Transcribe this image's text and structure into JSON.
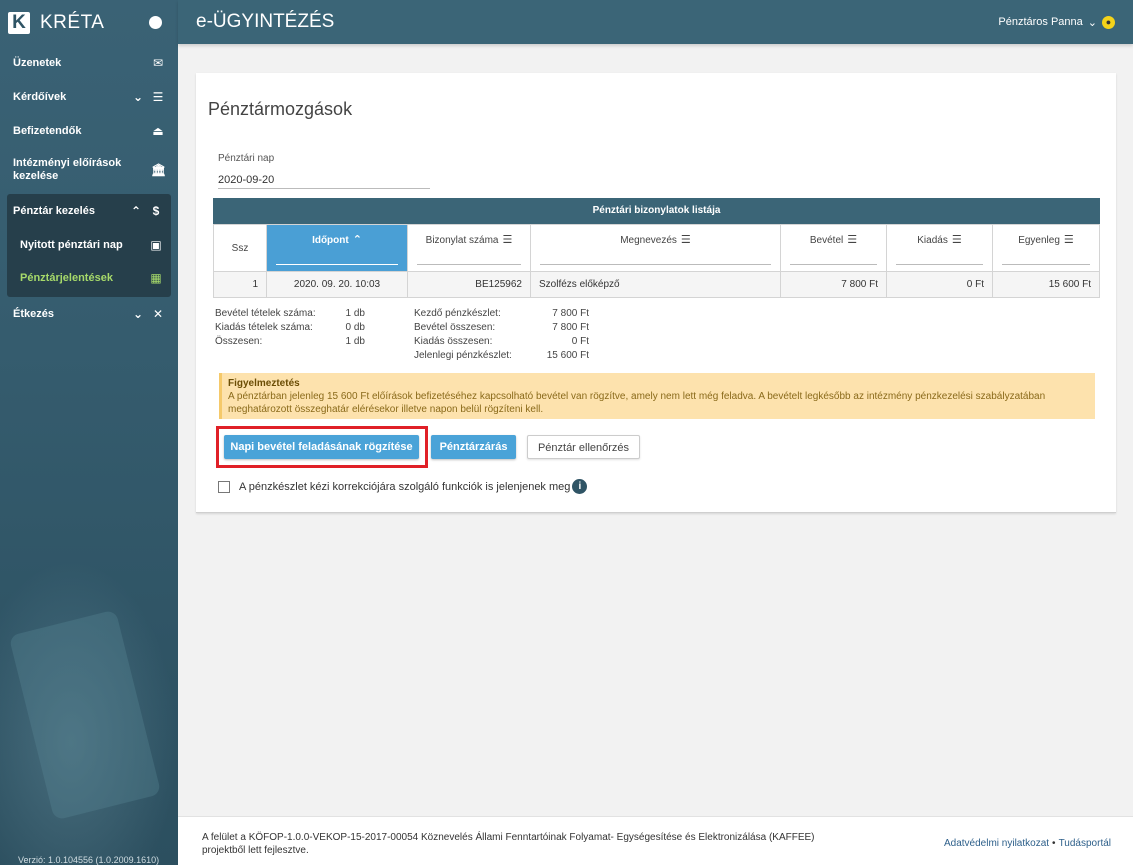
{
  "app": {
    "logo_letter": "K",
    "name": "KRÉTA",
    "module_title": "e-ÜGYINTÉZÉS",
    "user_name": "Pénztáros Panna",
    "version": "Verzió: 1.0.104556 (1.0.2009.1610)"
  },
  "sidebar": {
    "items": [
      {
        "label": "Üzenetek",
        "icon": "envelope-icon"
      },
      {
        "label": "Kérdőívek",
        "icon": "list-icon"
      },
      {
        "label": "Befizetendők",
        "icon": "stamp-icon"
      },
      {
        "label": "Intézményi előírások kezelése",
        "icon": "bank-icon"
      },
      {
        "label": "Pénztár kezelés",
        "icon": "dollar-icon"
      },
      {
        "label": "Étkezés",
        "icon": "cutlery-icon"
      }
    ],
    "subitems": [
      {
        "label": "Nyitott pénztári nap",
        "icon": "calendar-icon"
      },
      {
        "label": "Pénztárjelentések",
        "icon": "table-icon"
      }
    ]
  },
  "page": {
    "title": "Pénztármozgások",
    "date_label": "Pénztári nap",
    "date_value": "2020-09-20"
  },
  "table": {
    "caption": "Pénztári bizonylatok listája",
    "headers": [
      "Ssz",
      "Időpont",
      "Bizonylat száma",
      "Megnevezés",
      "Bevétel",
      "Kiadás",
      "Egyenleg"
    ],
    "rows": [
      [
        "1",
        "2020. 09. 20. 10:03",
        "BE125962",
        "Szolfézs előképző",
        "7 800 Ft",
        "0 Ft",
        "15 600 Ft"
      ]
    ]
  },
  "summary_left": [
    {
      "k": "Bevétel tételek száma:",
      "v": "1 db"
    },
    {
      "k": "Kiadás tételek száma:",
      "v": "0 db"
    },
    {
      "k": "Összesen:",
      "v": "1 db"
    }
  ],
  "summary_mid": [
    {
      "k": "Kezdő pénzkészlet:",
      "v": "7 800 Ft"
    },
    {
      "k": "Bevétel összesen:",
      "v": "7 800 Ft"
    },
    {
      "k": "Kiadás összesen:",
      "v": "0 Ft"
    },
    {
      "k": "Jelenlegi pénzkészlet:",
      "v": "15 600 Ft"
    }
  ],
  "alert": {
    "title": "Figyelmeztetés",
    "text": "A pénztárban jelenleg 15 600 Ft előírások befizetéséhez kapcsolható bevétel van rögzítve, amely nem lett még feladva. A bevételt legkésőbb az intézmény pénzkezelési szabályzatában meghatározott összeghatár elérésekor illetve napon belül rögzíteni kell."
  },
  "buttons": {
    "napi": "Napi bevétel feladásának rögzítése",
    "zaras": "Pénztárzárás",
    "ellenorzes": "Pénztár ellenőrzés"
  },
  "checkbox_label": "A pénzkészlet kézi korrekciójára szolgáló funkciók is jelenjenek meg",
  "footer": {
    "text": "A felület a KÖFOP-1.0.0-VEKOP-15-2017-00054 Köznevelés Állami Fenntartóinak Folyamat- Egységesítése és Elektronizálása (KAFFEE) projektből lett fejlesztve.",
    "link1": "Adatvédelmi nyilatkozat",
    "sep": "•",
    "link2": "Tudásportál"
  },
  "colors": {
    "sidebar": "#355c6e",
    "topbar": "#3b6577",
    "accent": "#4aa3d8",
    "active_green": "#a6d96a",
    "alert_bg": "#fde2ad",
    "highlight": "#e02027"
  }
}
